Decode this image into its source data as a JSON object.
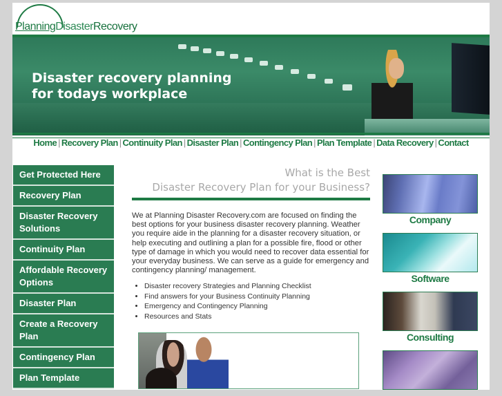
{
  "logo": {
    "part1": "Planning",
    "part2": "Disaster",
    "part3": "Recovery"
  },
  "banner": {
    "headline_line1": "Disaster recovery planning",
    "headline_line2": "for todays workplace"
  },
  "nav": {
    "items": [
      "Home",
      "Recovery Plan",
      "Continuity Plan",
      "Disaster Plan",
      "Contingency Plan",
      "Plan Template",
      "Data Recovery",
      "Contact"
    ],
    "separator": "|"
  },
  "sidebar": {
    "items": [
      "Get Protected Here",
      "Recovery Plan",
      "Disaster Recovery Solutions",
      "Continuity Plan",
      "Affordable Recovery Options",
      "Disaster Plan",
      "Create a Recovery Plan",
      "Contingency Plan",
      "Plan Template"
    ]
  },
  "main": {
    "heading_line1": "What is the Best",
    "heading_line2": "Disaster Recovery Plan for your Business?",
    "body": "We at Planning Disaster Recovery.com are focused on finding the best options for your business disaster recovery planning. Weather you require aide in the planning for a disaster recovery situation, or help executing and outlining a plan for a possible fire, flood or other type of damage in which you would need to recover data essential for your everyday business. We can serve as a guide for emergency and contingency planning/ management.",
    "bullets": [
      "Disaster recovery Strategies and Planning Checklist",
      "Find answers for your Business Continuity Planning",
      "Emergency and Contingency Planning",
      "Resources and Stats"
    ]
  },
  "right": {
    "tiles": [
      {
        "caption": "Company"
      },
      {
        "caption": "Software"
      },
      {
        "caption": "Consulting"
      },
      {
        "caption": ""
      }
    ]
  },
  "colors": {
    "brand_green": "#1e7a44",
    "sidebar_green": "#2a7c52",
    "heading_gray": "#a8a8a8",
    "page_bg": "#d4d4d4"
  }
}
